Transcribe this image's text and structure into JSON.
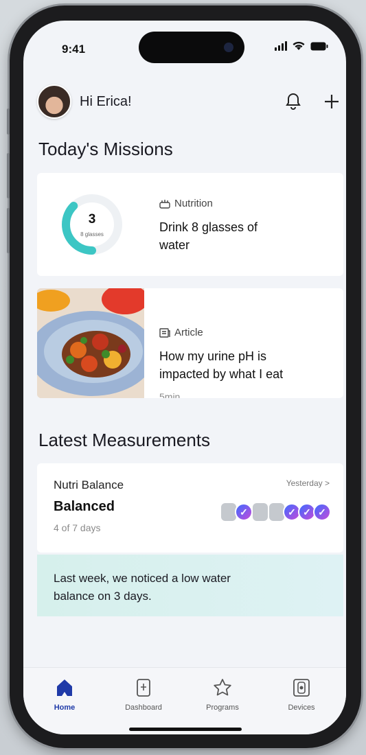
{
  "status": {
    "time": "9:41"
  },
  "header": {
    "greeting": "Hi Erica!"
  },
  "missions": {
    "title": "Today's Missions",
    "water": {
      "tag": "Nutrition",
      "title_line1": "Drink 8 glasses of",
      "title_line2": "water",
      "count": "3",
      "sub": "8 glasses",
      "progress_fraction": 0.375
    },
    "article": {
      "tag": "Article",
      "title_line1": "How my urine pH is",
      "title_line2": "impacted by what I eat",
      "duration": "5min"
    }
  },
  "measurements": {
    "title": "Latest Measurements",
    "card": {
      "label": "Nutri Balance",
      "value": "Balanced",
      "days": "4 of 7 days",
      "when": "Yesterday >",
      "week": [
        "none",
        "check",
        "none",
        "none",
        "check",
        "check",
        "check"
      ]
    },
    "notice_line1": "Last week, we noticed a low water",
    "notice_line2": "balance on 3 days."
  },
  "tabs": [
    {
      "label": "Home",
      "icon": "home-icon",
      "active": true
    },
    {
      "label": "Dashboard",
      "icon": "dashboard-icon",
      "active": false
    },
    {
      "label": "Programs",
      "icon": "star-icon",
      "active": false
    },
    {
      "label": "Devices",
      "icon": "device-icon",
      "active": false
    }
  ],
  "colors": {
    "accent": "#1f3aa8",
    "water": "#3cc6c4",
    "check_start": "#3d6bff",
    "check_end": "#c54bd9",
    "notice_bg": "#d6f0ec"
  }
}
